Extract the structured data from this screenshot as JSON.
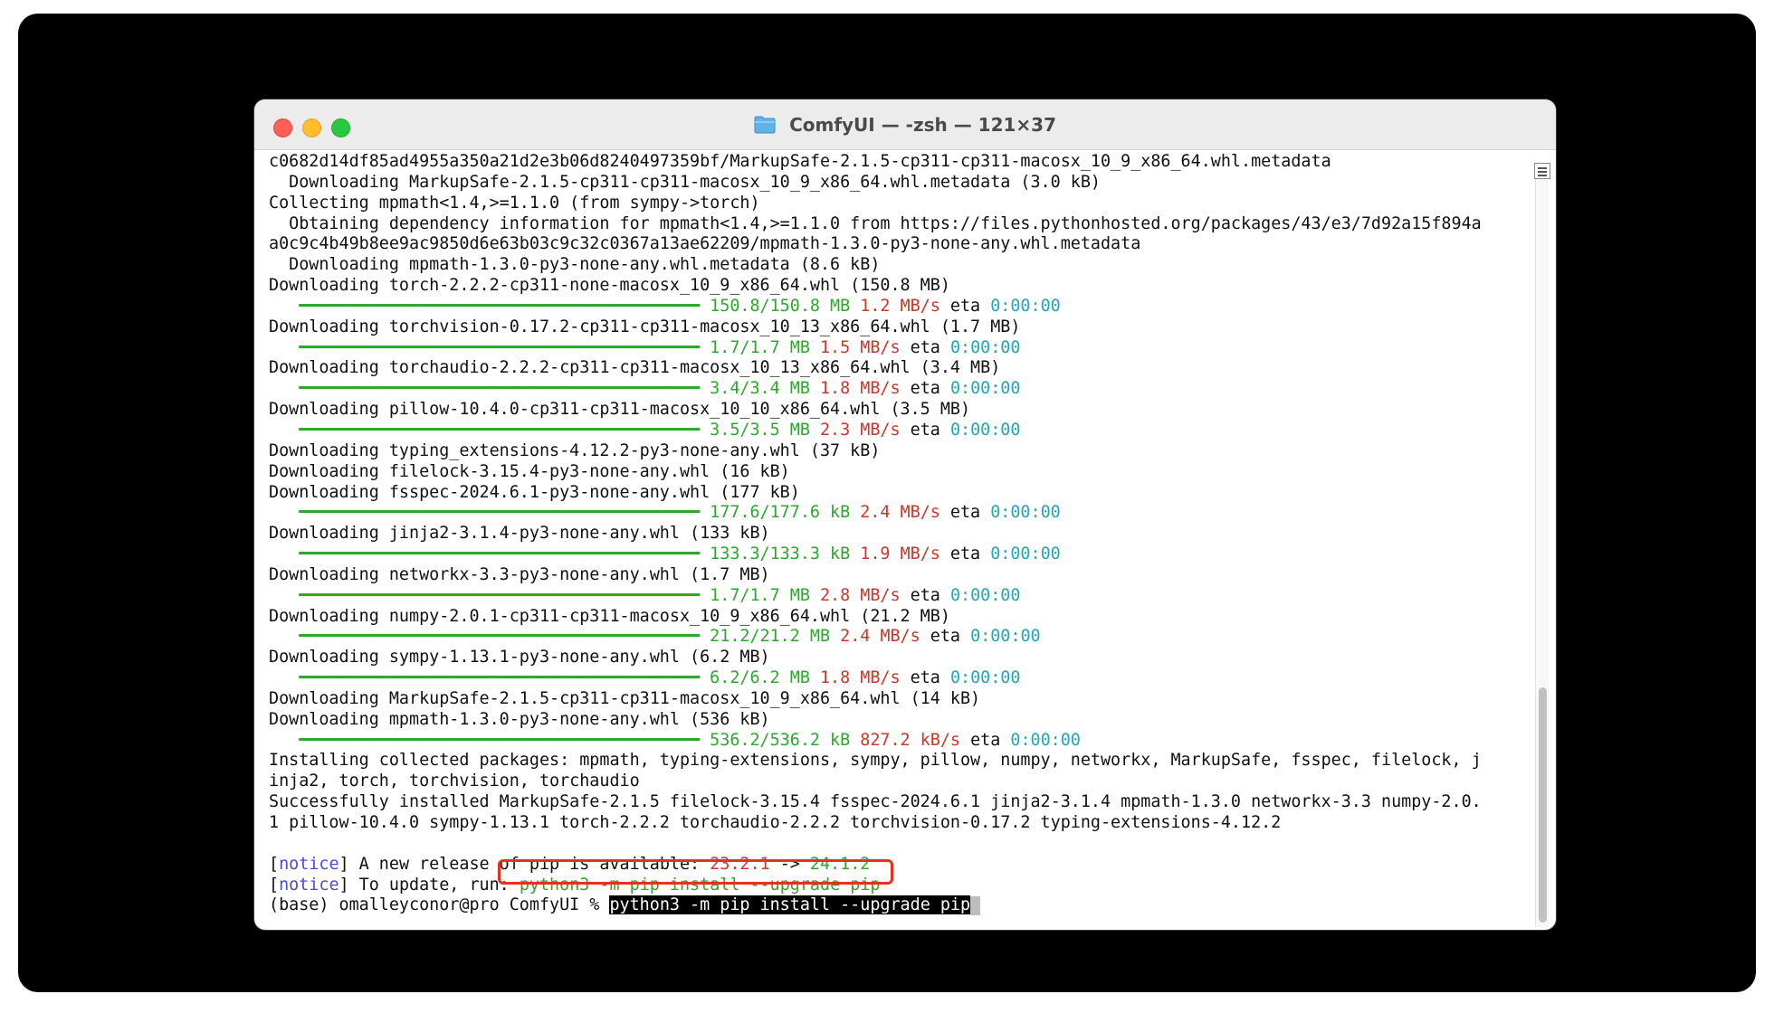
{
  "window": {
    "title": "ComfyUI — -zsh — 121×37"
  },
  "terminal": {
    "lines": [
      {
        "segments": [
          {
            "t": "c0682d14df85ad4955a350a21d2e3b06d8240497359bf/MarkupSafe-2.1.5-cp311-cp311-macosx_10_9_x86_64.whl.metadata",
            "c": ""
          }
        ]
      },
      {
        "segments": [
          {
            "t": "  Downloading MarkupSafe-2.1.5-cp311-cp311-macosx_10_9_x86_64.whl.metadata (3.0 kB)",
            "c": ""
          }
        ]
      },
      {
        "segments": [
          {
            "t": "Collecting mpmath<1.4,>=1.1.0 (from sympy->torch)",
            "c": ""
          }
        ]
      },
      {
        "segments": [
          {
            "t": "  Obtaining dependency information for mpmath<1.4,>=1.1.0 from https://files.pythonhosted.org/packages/43/e3/7d92a15f894a",
            "c": ""
          }
        ]
      },
      {
        "segments": [
          {
            "t": "a0c9c4b49b8ee9ac9850d6e63b03c9c32c0367a13ae62209/mpmath-1.3.0-py3-none-any.whl.metadata",
            "c": ""
          }
        ]
      },
      {
        "segments": [
          {
            "t": "  Downloading mpmath-1.3.0-py3-none-any.whl.metadata (8.6 kB)",
            "c": ""
          }
        ]
      },
      {
        "segments": [
          {
            "t": "Downloading torch-2.2.2-cp311-none-macosx_10_9_x86_64.whl (150.8 MB)",
            "c": ""
          }
        ]
      },
      {
        "segments": [
          {
            "t": "   ━━━━━━━━━━━━━━━━━━━━━━━━━━━━━━━━━━━━━━━━ 150.8/150.8 MB",
            "c": "g"
          },
          {
            "t": " ",
            "c": ""
          },
          {
            "t": "1.2 MB/s",
            "c": "r"
          },
          {
            "t": " eta ",
            "c": ""
          },
          {
            "t": "0:00:00",
            "c": "c"
          }
        ]
      },
      {
        "segments": [
          {
            "t": "Downloading torchvision-0.17.2-cp311-cp311-macosx_10_13_x86_64.whl (1.7 MB)",
            "c": ""
          }
        ]
      },
      {
        "segments": [
          {
            "t": "   ━━━━━━━━━━━━━━━━━━━━━━━━━━━━━━━━━━━━━━━━ 1.7/1.7 MB",
            "c": "g"
          },
          {
            "t": " ",
            "c": ""
          },
          {
            "t": "1.5 MB/s",
            "c": "r"
          },
          {
            "t": " eta ",
            "c": ""
          },
          {
            "t": "0:00:00",
            "c": "c"
          }
        ]
      },
      {
        "segments": [
          {
            "t": "Downloading torchaudio-2.2.2-cp311-cp311-macosx_10_13_x86_64.whl (3.4 MB)",
            "c": ""
          }
        ]
      },
      {
        "segments": [
          {
            "t": "   ━━━━━━━━━━━━━━━━━━━━━━━━━━━━━━━━━━━━━━━━ 3.4/3.4 MB",
            "c": "g"
          },
          {
            "t": " ",
            "c": ""
          },
          {
            "t": "1.8 MB/s",
            "c": "r"
          },
          {
            "t": " eta ",
            "c": ""
          },
          {
            "t": "0:00:00",
            "c": "c"
          }
        ]
      },
      {
        "segments": [
          {
            "t": "Downloading pillow-10.4.0-cp311-cp311-macosx_10_10_x86_64.whl (3.5 MB)",
            "c": ""
          }
        ]
      },
      {
        "segments": [
          {
            "t": "   ━━━━━━━━━━━━━━━━━━━━━━━━━━━━━━━━━━━━━━━━ 3.5/3.5 MB",
            "c": "g"
          },
          {
            "t": " ",
            "c": ""
          },
          {
            "t": "2.3 MB/s",
            "c": "r"
          },
          {
            "t": " eta ",
            "c": ""
          },
          {
            "t": "0:00:00",
            "c": "c"
          }
        ]
      },
      {
        "segments": [
          {
            "t": "Downloading typing_extensions-4.12.2-py3-none-any.whl (37 kB)",
            "c": ""
          }
        ]
      },
      {
        "segments": [
          {
            "t": "Downloading filelock-3.15.4-py3-none-any.whl (16 kB)",
            "c": ""
          }
        ]
      },
      {
        "segments": [
          {
            "t": "Downloading fsspec-2024.6.1-py3-none-any.whl (177 kB)",
            "c": ""
          }
        ]
      },
      {
        "segments": [
          {
            "t": "   ━━━━━━━━━━━━━━━━━━━━━━━━━━━━━━━━━━━━━━━━ 177.6/177.6 kB",
            "c": "g"
          },
          {
            "t": " ",
            "c": ""
          },
          {
            "t": "2.4 MB/s",
            "c": "r"
          },
          {
            "t": " eta ",
            "c": ""
          },
          {
            "t": "0:00:00",
            "c": "c"
          }
        ]
      },
      {
        "segments": [
          {
            "t": "Downloading jinja2-3.1.4-py3-none-any.whl (133 kB)",
            "c": ""
          }
        ]
      },
      {
        "segments": [
          {
            "t": "   ━━━━━━━━━━━━━━━━━━━━━━━━━━━━━━━━━━━━━━━━ 133.3/133.3 kB",
            "c": "g"
          },
          {
            "t": " ",
            "c": ""
          },
          {
            "t": "1.9 MB/s",
            "c": "r"
          },
          {
            "t": " eta ",
            "c": ""
          },
          {
            "t": "0:00:00",
            "c": "c"
          }
        ]
      },
      {
        "segments": [
          {
            "t": "Downloading networkx-3.3-py3-none-any.whl (1.7 MB)",
            "c": ""
          }
        ]
      },
      {
        "segments": [
          {
            "t": "   ━━━━━━━━━━━━━━━━━━━━━━━━━━━━━━━━━━━━━━━━ 1.7/1.7 MB",
            "c": "g"
          },
          {
            "t": " ",
            "c": ""
          },
          {
            "t": "2.8 MB/s",
            "c": "r"
          },
          {
            "t": " eta ",
            "c": ""
          },
          {
            "t": "0:00:00",
            "c": "c"
          }
        ]
      },
      {
        "segments": [
          {
            "t": "Downloading numpy-2.0.1-cp311-cp311-macosx_10_9_x86_64.whl (21.2 MB)",
            "c": ""
          }
        ]
      },
      {
        "segments": [
          {
            "t": "   ━━━━━━━━━━━━━━━━━━━━━━━━━━━━━━━━━━━━━━━━ 21.2/21.2 MB",
            "c": "g"
          },
          {
            "t": " ",
            "c": ""
          },
          {
            "t": "2.4 MB/s",
            "c": "r"
          },
          {
            "t": " eta ",
            "c": ""
          },
          {
            "t": "0:00:00",
            "c": "c"
          }
        ]
      },
      {
        "segments": [
          {
            "t": "Downloading sympy-1.13.1-py3-none-any.whl (6.2 MB)",
            "c": ""
          }
        ]
      },
      {
        "segments": [
          {
            "t": "   ━━━━━━━━━━━━━━━━━━━━━━━━━━━━━━━━━━━━━━━━ 6.2/6.2 MB",
            "c": "g"
          },
          {
            "t": " ",
            "c": ""
          },
          {
            "t": "1.8 MB/s",
            "c": "r"
          },
          {
            "t": " eta ",
            "c": ""
          },
          {
            "t": "0:00:00",
            "c": "c"
          }
        ]
      },
      {
        "segments": [
          {
            "t": "Downloading MarkupSafe-2.1.5-cp311-cp311-macosx_10_9_x86_64.whl (14 kB)",
            "c": ""
          }
        ]
      },
      {
        "segments": [
          {
            "t": "Downloading mpmath-1.3.0-py3-none-any.whl (536 kB)",
            "c": ""
          }
        ]
      },
      {
        "segments": [
          {
            "t": "   ━━━━━━━━━━━━━━━━━━━━━━━━━━━━━━━━━━━━━━━━ 536.2/536.2 kB",
            "c": "g"
          },
          {
            "t": " ",
            "c": ""
          },
          {
            "t": "827.2 kB/s",
            "c": "r"
          },
          {
            "t": " eta ",
            "c": ""
          },
          {
            "t": "0:00:00",
            "c": "c"
          }
        ]
      },
      {
        "segments": [
          {
            "t": "Installing collected packages: mpmath, typing-extensions, sympy, pillow, numpy, networkx, MarkupSafe, fsspec, filelock, j",
            "c": ""
          }
        ]
      },
      {
        "segments": [
          {
            "t": "inja2, torch, torchvision, torchaudio",
            "c": ""
          }
        ]
      },
      {
        "segments": [
          {
            "t": "Successfully installed MarkupSafe-2.1.5 filelock-3.15.4 fsspec-2024.6.1 jinja2-3.1.4 mpmath-1.3.0 networkx-3.3 numpy-2.0.",
            "c": ""
          }
        ]
      },
      {
        "segments": [
          {
            "t": "1 pillow-10.4.0 sympy-1.13.1 torch-2.2.2 torchaudio-2.2.2 torchvision-0.17.2 typing-extensions-4.12.2",
            "c": ""
          }
        ]
      },
      {
        "segments": [
          {
            "t": " ",
            "c": ""
          }
        ]
      },
      {
        "segments": [
          {
            "t": "[",
            "c": ""
          },
          {
            "t": "notice",
            "c": "b"
          },
          {
            "t": "] A new release of pip is available: ",
            "c": ""
          },
          {
            "t": "23.2.1",
            "c": "r"
          },
          {
            "t": " -> ",
            "c": ""
          },
          {
            "t": "24.1.2",
            "c": "g"
          }
        ]
      },
      {
        "segments": [
          {
            "t": "[",
            "c": ""
          },
          {
            "t": "notice",
            "c": "b"
          },
          {
            "t": "] To update, run: ",
            "c": ""
          },
          {
            "t": "python3 -m pip install --upgrade pip",
            "c": "g"
          }
        ]
      }
    ],
    "prompt": "(base) omalleyconor@pro ComfyUI % ",
    "command": "python3 -m pip install --upgrade pip"
  },
  "colors": {
    "green": "#2fa72f",
    "red": "#c8382b",
    "cyan": "#26a6b0",
    "notice": "#4a4ad8",
    "highlight_box": "#e5321f"
  }
}
